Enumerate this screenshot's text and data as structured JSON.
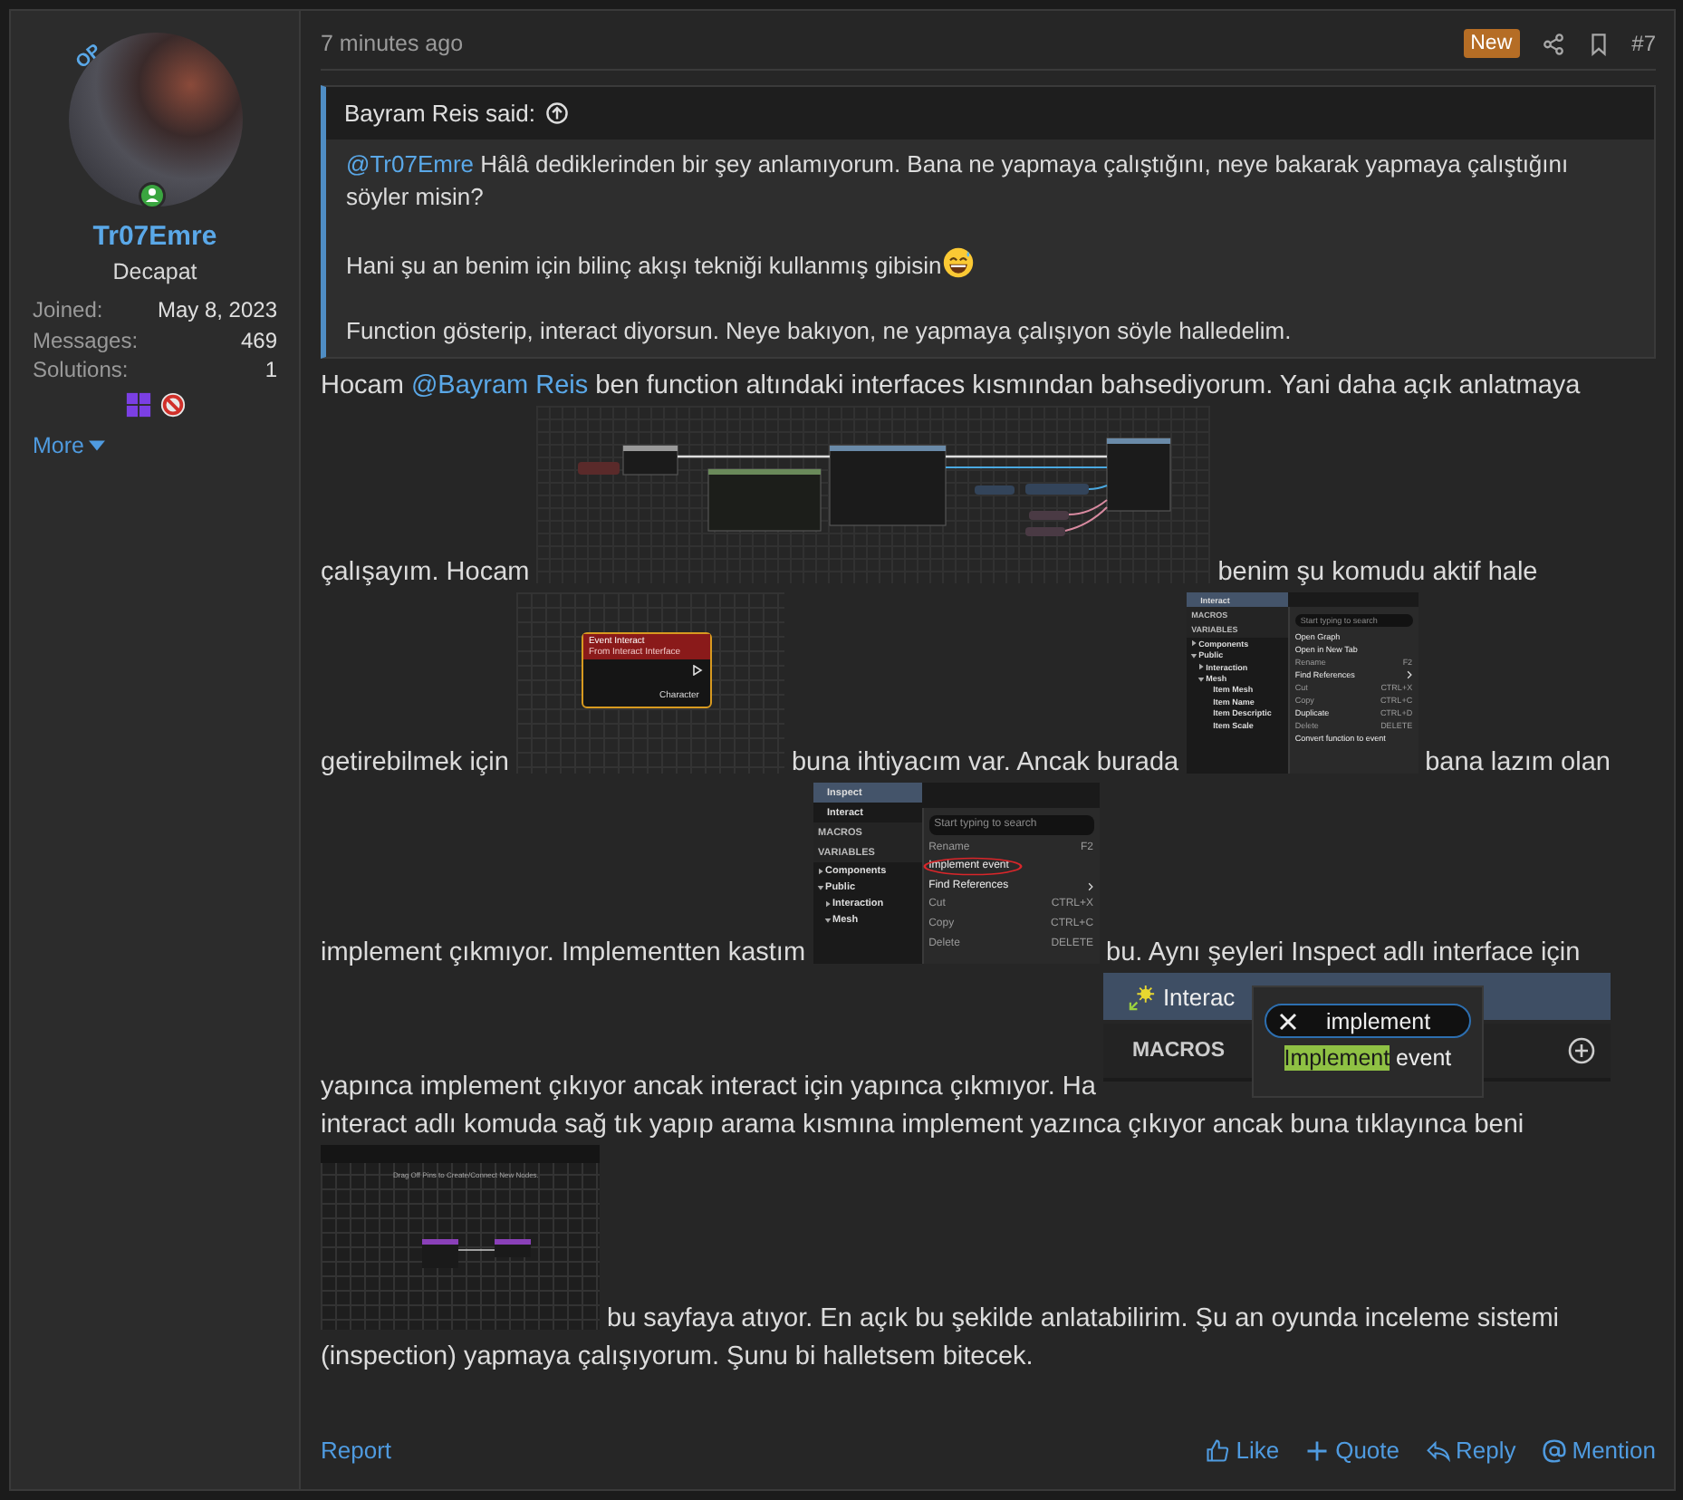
{
  "author": {
    "op_badge": "OP",
    "online": true,
    "name": "Tr07Emre",
    "title": "Decapat",
    "stats": [
      {
        "label": "Joined:",
        "value": "May 8, 2023"
      },
      {
        "label": "Messages:",
        "value": "469"
      },
      {
        "label": "Solutions:",
        "value": "1"
      }
    ],
    "more": "More"
  },
  "post": {
    "time": "7 minutes ago",
    "badge": "New",
    "number": "#7"
  },
  "quote": {
    "author_line": "Bayram Reis said:",
    "paragraphs": [
      [
        {
          "kind": "mention",
          "text": "@Tr07Emre"
        },
        {
          "kind": "text",
          "text": " Hâlâ dediklerinden bir şey anlamıyorum. Bana ne yapmaya çalıştığını, neye bakarak yapmaya çalıştığını söyler misin?"
        }
      ],
      [
        {
          "kind": "text",
          "text": "Hani şu an benim için bilinç akışı tekniği kullanmış gibisin"
        },
        {
          "kind": "emoji"
        }
      ],
      [
        {
          "kind": "text",
          "text": "Function gösterip, interact diyorsun. Neye bakıyon, ne yapmaya çalışıyon söyle halledelim."
        }
      ]
    ]
  },
  "body": [
    {
      "segments": [
        {
          "kind": "text",
          "text": "Hocam"
        },
        {
          "kind": "mention",
          "text": "@Bayram Reis"
        },
        {
          "kind": "text",
          "text": "ben function altındaki interfaces kısmından bahsediyorum. Yani daha açık anlatmaya"
        }
      ]
    },
    {
      "segments": [
        {
          "kind": "text",
          "text": "çalışayım. Hocam"
        },
        {
          "kind": "image",
          "screenshot": {
            "kind": "graph"
          }
        },
        {
          "kind": "text",
          "text": "benim şu komudu aktif hale"
        }
      ]
    },
    {
      "segments": [
        {
          "kind": "text",
          "text": "getirebilmek için"
        },
        {
          "kind": "image",
          "screenshot": {
            "kind": "node",
            "title": "Event Interact",
            "subtitle": "From Interact Interface",
            "pin": "Character"
          }
        },
        {
          "kind": "text",
          "text": "buna ihtiyacım var. Ancak burada"
        },
        {
          "kind": "image",
          "screenshot": {
            "kind": "menu",
            "functions": [
              {
                "label": "Interact",
                "selected": true
              }
            ],
            "macros_label": "MACROS",
            "variables_label": "VARIABLES",
            "variables": [
              {
                "label": "Components",
                "expanded": false
              },
              {
                "label": "Public",
                "expanded": true,
                "children": [
                  {
                    "label": "Interaction",
                    "expanded": false
                  },
                  {
                    "label": "Mesh",
                    "expanded": true,
                    "children": [
                      {
                        "label": "Item Mesh"
                      },
                      {
                        "label": "Item Name"
                      },
                      {
                        "label": "Item Descriptic"
                      },
                      {
                        "label": "Item Scale"
                      }
                    ]
                  }
                ]
              }
            ],
            "placeholder": "Start typing to search",
            "items": [
              {
                "kind": "item",
                "label": "Open Graph",
                "disabled": false,
                "circled": false
              },
              {
                "kind": "item",
                "label": "Open in New Tab",
                "disabled": false,
                "circled": false
              },
              {
                "kind": "item",
                "label": "Rename",
                "shortcut": "F2",
                "disabled": true,
                "circled": false
              },
              {
                "kind": "submenu",
                "label": "Find References",
                "disabled": false,
                "circled": false
              },
              {
                "kind": "item",
                "label": "Cut",
                "shortcut": "CTRL+X",
                "disabled": true,
                "circled": false
              },
              {
                "kind": "item",
                "label": "Copy",
                "shortcut": "CTRL+C",
                "disabled": true,
                "circled": false
              },
              {
                "kind": "item",
                "label": "Duplicate",
                "shortcut": "CTRL+D",
                "disabled": false,
                "circled": false
              },
              {
                "kind": "item",
                "label": "Delete",
                "shortcut": "DELETE",
                "disabled": true,
                "circled": false
              },
              {
                "kind": "item",
                "label": "Convert function to event",
                "disabled": false,
                "circled": false
              }
            ]
          }
        },
        {
          "kind": "text",
          "text": "bana lazım olan"
        }
      ]
    },
    {
      "segments": [
        {
          "kind": "text",
          "text": "implement çıkmıyor. Implementten kastım"
        },
        {
          "kind": "image",
          "screenshot": {
            "kind": "zoomedmenu",
            "functions": [
              {
                "label": "Inspect",
                "selected": true
              },
              {
                "label": "Interact",
                "selected": false
              }
            ],
            "macros_label": "MACROS",
            "variables_label": "VARIABLES",
            "variables": [
              {
                "label": "Components",
                "expanded": false
              },
              {
                "label": "Public",
                "expanded": true,
                "children": [
                  {
                    "label": "Interaction",
                    "expanded": false
                  },
                  {
                    "label": "Mesh",
                    "expanded": true
                  }
                ]
              }
            ],
            "placeholder": "Start typing to search",
            "items": [
              {
                "kind": "item",
                "label": "Rename",
                "shortcut": "F2",
                "disabled": true,
                "circled": false
              },
              {
                "kind": "item",
                "label": "Implement event",
                "disabled": false,
                "circled": true
              },
              {
                "kind": "submenu",
                "label": "Find References",
                "disabled": false,
                "circled": false
              },
              {
                "kind": "item",
                "label": "Cut",
                "shortcut": "CTRL+X",
                "disabled": true,
                "circled": false
              },
              {
                "kind": "item",
                "label": "Copy",
                "shortcut": "CTRL+C",
                "disabled": true,
                "circled": false
              },
              {
                "kind": "item",
                "label": "Delete",
                "shortcut": "DELETE",
                "disabled": true,
                "circled": false
              }
            ]
          }
        },
        {
          "kind": "text",
          "text": "bu. Aynı şeyleri Inspect adlı interface için"
        }
      ]
    },
    {
      "segments": [
        {
          "kind": "text",
          "text": "yapınca implement çıkıyor ancak interact için yapınca çıkmıyor. Ha"
        },
        {
          "kind": "image",
          "screenshot": {
            "kind": "search",
            "function_label": "Interac",
            "macros_label": "MACROS",
            "query": "implement",
            "match": "Implement",
            "rest": " event"
          }
        }
      ]
    },
    {
      "segments": [
        {
          "kind": "text",
          "text": "interact adlı komuda sağ tık yapıp arama kısmına implement yazınca çıkıyor ancak buna tıklayınca beni"
        }
      ]
    },
    {
      "segments": [
        {
          "kind": "image",
          "screenshot": {
            "kind": "graph2",
            "hint": "Drag Off Pins to Create/Connect New Nodes."
          }
        },
        {
          "kind": "text",
          "text": "bu sayfaya atıyor. En açık bu şekilde anlatabilirim. Şu an oyunda inceleme sistemi"
        }
      ]
    },
    {
      "segments": [
        {
          "kind": "text",
          "text": "(inspection) yapmaya çalışıyorum. Şunu bi halletsem bitecek."
        }
      ]
    }
  ],
  "footer": {
    "report": "Report",
    "actions": [
      {
        "kind": "like",
        "label": "Like"
      },
      {
        "kind": "quote",
        "label": "Quote"
      },
      {
        "kind": "reply",
        "label": "Reply"
      },
      {
        "kind": "mention",
        "label": "Mention"
      }
    ]
  }
}
